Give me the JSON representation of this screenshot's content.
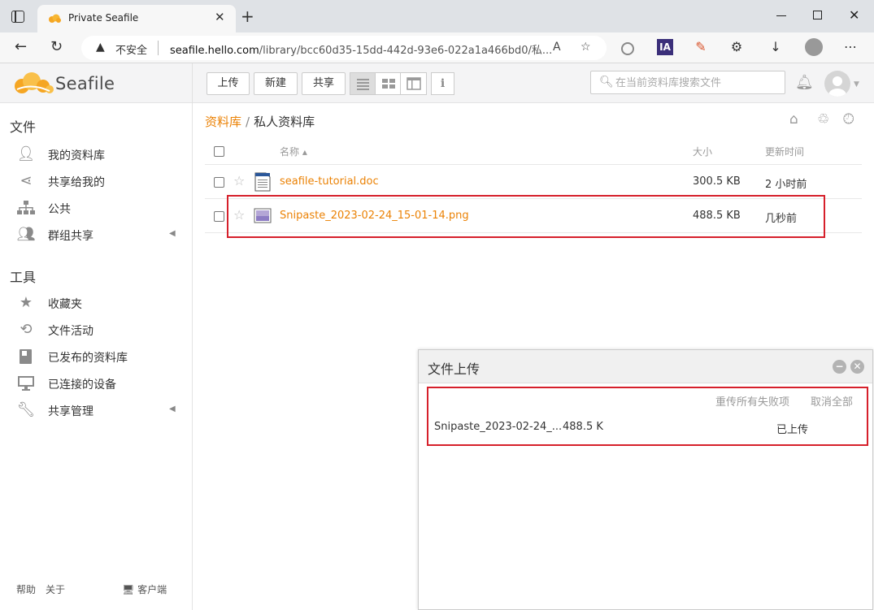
{
  "browser": {
    "tab_title": "Private Seafile",
    "url_security": "不安全",
    "url_host": "seafile.hello.com",
    "url_path": "/library/bcc60d35-15dd-442d-93e6-022a1a466bd0/私...",
    "ext_ia_label": "IA"
  },
  "header": {
    "logo_text": "Seafile",
    "upload_label": "上传",
    "new_label": "新建",
    "share_label": "共享",
    "search_placeholder": "在当前资料库搜索文件"
  },
  "sidebar": {
    "files_heading": "文件",
    "files_items": [
      {
        "label": "我的资料库",
        "icon": "user-icon"
      },
      {
        "label": "共享给我的",
        "icon": "share-icon"
      },
      {
        "label": "公共",
        "icon": "org-icon"
      },
      {
        "label": "群组共享",
        "icon": "group-icon"
      }
    ],
    "tools_heading": "工具",
    "tools_items": [
      {
        "label": "收藏夹",
        "icon": "star-icon"
      },
      {
        "label": "文件活动",
        "icon": "history-icon"
      },
      {
        "label": "已发布的资料库",
        "icon": "book-icon"
      },
      {
        "label": "已连接的设备",
        "icon": "monitor-icon"
      },
      {
        "label": "共享管理",
        "icon": "wrench-icon"
      }
    ],
    "footer": {
      "help": "帮助",
      "about": "关于",
      "client": "客户端"
    }
  },
  "breadcrumb": {
    "root": "资料库",
    "separator": "/",
    "current": "私人资料库"
  },
  "table": {
    "headers": {
      "name": "名称 ▴",
      "size": "大小",
      "updated": "更新时间"
    },
    "rows": [
      {
        "name": "seafile-tutorial.doc",
        "size": "300.5 KB",
        "updated": "2 小时前",
        "type": "doc"
      },
      {
        "name": "Snipaste_2023-02-24_15-01-14.png",
        "size": "488.5 KB",
        "updated": "几秒前",
        "type": "image"
      }
    ]
  },
  "upload_dialog": {
    "title": "文件上传",
    "retry_all": "重传所有失败项",
    "cancel_all": "取消全部",
    "item": {
      "name": "Snipaste_2023-02-24_...",
      "size": "488.5 K",
      "status": "已上传"
    }
  },
  "colors": {
    "accent": "#eb8205",
    "highlight": "#d6202b"
  }
}
